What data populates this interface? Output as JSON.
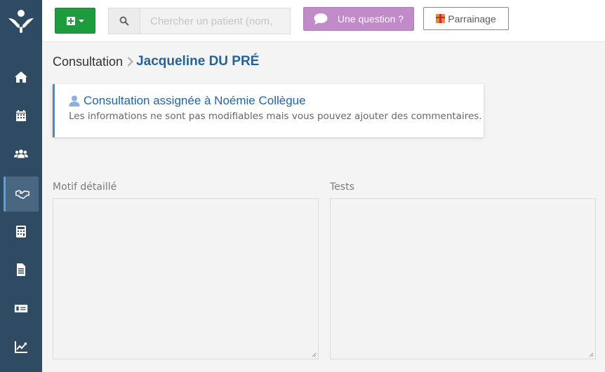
{
  "sidebar": {
    "logo_icon": "medical-person-icon",
    "items": [
      {
        "id": "home",
        "icon": "home-icon"
      },
      {
        "id": "calendar",
        "icon": "calendar-icon"
      },
      {
        "id": "patients",
        "icon": "users-icon"
      },
      {
        "id": "consultations",
        "icon": "handshake-icon",
        "active": true
      },
      {
        "id": "calculator",
        "icon": "calculator-icon"
      },
      {
        "id": "documents",
        "icon": "document-icon"
      },
      {
        "id": "billing",
        "icon": "money-card-icon"
      },
      {
        "id": "stats",
        "icon": "chart-line-icon"
      }
    ]
  },
  "topbar": {
    "add_icon": "plus-square-icon",
    "search": {
      "placeholder": "Chercher un patient (nom,",
      "value": ""
    },
    "question_label": "Une question ?",
    "referral_label": "Parrainage"
  },
  "breadcrumb": {
    "root": "Consultation",
    "current": "Jacqueline DU PRÉ"
  },
  "notice": {
    "title": "Consultation assignée à Noémie Collègue",
    "subtitle": "Les informations ne sont pas modifiables mais vous pouvez ajouter des commentaires."
  },
  "fields": {
    "motif_label": "Motif détaillé",
    "motif_value": "",
    "tests_label": "Tests",
    "tests_value": ""
  },
  "colors": {
    "sidebar_bg": "#2f4a63",
    "add_green": "#1e9b3d",
    "question_purple": "#c18ac9",
    "link_blue": "#2264a8"
  }
}
